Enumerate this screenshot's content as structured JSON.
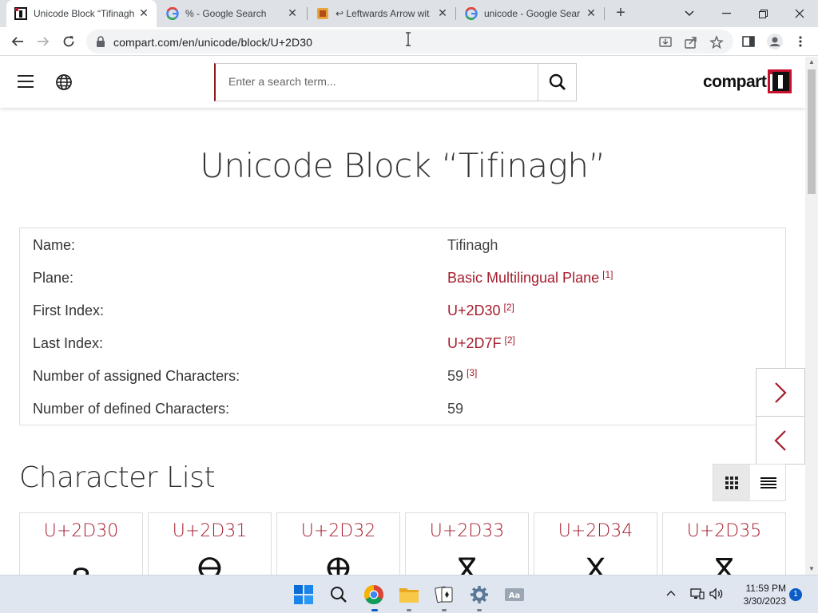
{
  "browser": {
    "tabs": [
      {
        "title": "Unicode Block “Tifinagh”",
        "active": true,
        "icon": "compart-favicon"
      },
      {
        "title": "% - Google Search",
        "active": false,
        "icon": "google-favicon"
      },
      {
        "title": "↩ Leftwards Arrow with",
        "active": false,
        "icon": "arrow-favicon"
      },
      {
        "title": "unicode - Google Search",
        "active": false,
        "icon": "google-favicon"
      }
    ],
    "url": "compart.com/en/unicode/block/U+2D30",
    "close_glyph": "✕",
    "new_tab_glyph": "+"
  },
  "site": {
    "logo_text": "compart",
    "search_placeholder": "Enter a search term..."
  },
  "page": {
    "title": "Unicode Block “Tifinagh”",
    "info": [
      {
        "label": "Name:",
        "value": "Tifinagh",
        "link": false,
        "ref": ""
      },
      {
        "label": "Plane:",
        "value": "Basic Multilingual Plane",
        "link": true,
        "ref": "[1]"
      },
      {
        "label": "First Index:",
        "value": "U+2D30",
        "link": true,
        "ref": "[2]"
      },
      {
        "label": "Last Index:",
        "value": "U+2D7F",
        "link": true,
        "ref": "[2]"
      },
      {
        "label": "Number of assigned Characters:",
        "value": "59",
        "link": false,
        "ref": "[3]"
      },
      {
        "label": "Number of defined Characters:",
        "value": "59",
        "link": false,
        "ref": ""
      }
    ],
    "section_title": "Character List",
    "characters": [
      {
        "code": "U+2D30",
        "glyph": "ⴰ"
      },
      {
        "code": "U+2D31",
        "glyph": "ⴱ"
      },
      {
        "code": "U+2D32",
        "glyph": "ⴲ"
      },
      {
        "code": "U+2D33",
        "glyph": "ⴳ"
      },
      {
        "code": "U+2D34",
        "glyph": "ⴴ"
      },
      {
        "code": "U+2D35",
        "glyph": "ⴵ"
      }
    ]
  },
  "taskbar": {
    "time": "11:59 PM",
    "date": "3/30/2023",
    "notification_count": "1"
  },
  "colors": {
    "accent": "#a51d2d",
    "tabstrip": "#dee1e6",
    "taskbar": "#dfe6f0"
  }
}
